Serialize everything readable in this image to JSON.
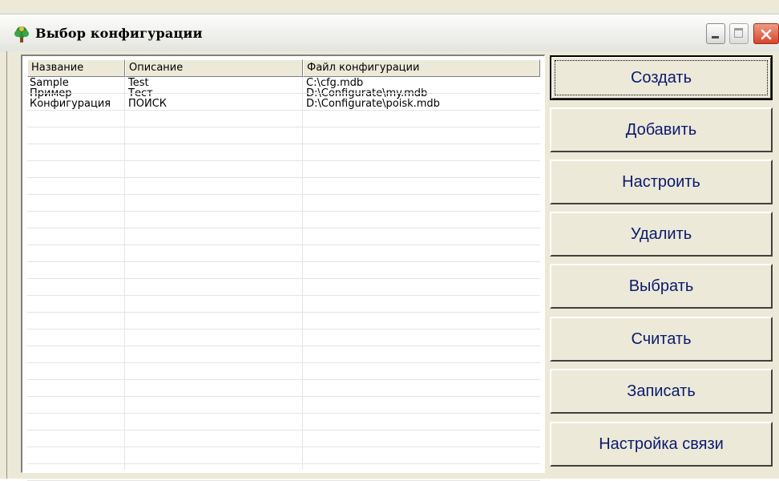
{
  "window": {
    "title": "Выбор конфигурации",
    "icon": "app-tree-icon"
  },
  "titlebar_controls": {
    "minimize": "minimize-icon",
    "maximize": "maximize-icon",
    "close": "close-icon"
  },
  "listview": {
    "columns": [
      "Название",
      "Описание",
      "Файл конфигурации"
    ],
    "rows": [
      [
        "Sample",
        "Test",
        "C:\\cfg.mdb"
      ],
      [
        "Пример",
        "Тест",
        "D:\\Configurate\\my.mdb"
      ],
      [
        "Конфигурация",
        "ПОИСК",
        "D:\\Configurate\\poisk.mdb"
      ]
    ]
  },
  "buttons": {
    "create": "Создать",
    "add": "Добавить",
    "configure": "Настроить",
    "delete": "Удалить",
    "select": "Выбрать",
    "read": "Считать",
    "write": "Записать",
    "connection": "Настройка связи"
  },
  "colors": {
    "button_text": "#0a1a6e",
    "face": "#ece9d8",
    "close_button": "#d6452a"
  }
}
